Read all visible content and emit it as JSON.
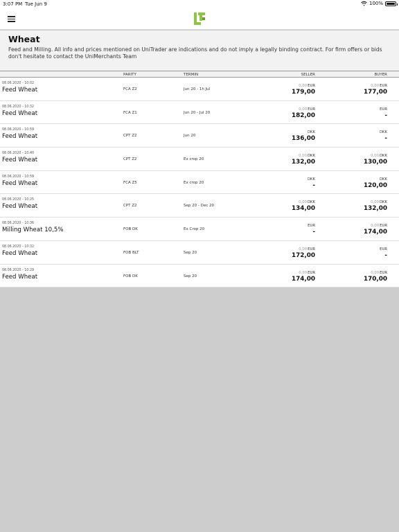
{
  "status_bar": {
    "time": "3:07 PM",
    "date": "Tue Jun 9",
    "battery": "100%"
  },
  "icons": {
    "menu": "hamburger-menu-icon",
    "logo": "unitrader-logo",
    "wifi": "wifi-icon",
    "battery": "battery-icon"
  },
  "colors": {
    "brand": "#8dc63f",
    "header_bg": "#f2f2f2",
    "body_bg": "#cccccc"
  },
  "header": {
    "title": "Wheat",
    "description": "Feed and Milling.  All info and prices mentioned on UniTrader are indications and do not imply a legally binding contract. For firm offers or bids don't hesitate to contact the UniMerchants Team"
  },
  "table": {
    "columns": {
      "parity": "PARITY",
      "termin": "TERMIN",
      "seller": "SELLER",
      "buyer": "BUYER"
    },
    "rows": [
      {
        "timestamp": "08.06.2020 - 10:02",
        "product": "Feed Wheat",
        "parity": "FCA Z2",
        "termin": "Jun 20 - 1h Jul",
        "seller_change": "0,00",
        "seller_currency": "EUR",
        "seller_price": "179,00",
        "buyer_change": "0,00",
        "buyer_currency": "EUR",
        "buyer_price": "177,00"
      },
      {
        "timestamp": "08.06.2020 - 10:32",
        "product": "Feed Wheat",
        "parity": "FCA Z1",
        "termin": "Jun 20 - Jul 20",
        "seller_change": "0,00",
        "seller_currency": "EUR",
        "seller_price": "182,00",
        "buyer_change": "",
        "buyer_currency": "EUR",
        "buyer_price": "-"
      },
      {
        "timestamp": "08.06.2020 - 10:59",
        "product": "Feed Wheat",
        "parity": "CPT Z2",
        "termin": "Jun 20",
        "seller_change": "",
        "seller_currency": "DKK",
        "seller_price": "136,00",
        "buyer_change": "",
        "buyer_currency": "DKK",
        "buyer_price": "-"
      },
      {
        "timestamp": "08.06.2020 - 10:40",
        "product": "Feed Wheat",
        "parity": "CPT Z2",
        "termin": "Ex crop 20",
        "seller_change": "0,00",
        "seller_currency": "DKK",
        "seller_price": "132,00",
        "buyer_change": "0,00",
        "buyer_currency": "DKK",
        "buyer_price": "130,00"
      },
      {
        "timestamp": "08.06.2020 - 10:59",
        "product": "Feed Wheat",
        "parity": "FCA Z5",
        "termin": "Ex crop 20",
        "seller_change": "",
        "seller_currency": "DKK",
        "seller_price": "-",
        "buyer_change": "",
        "buyer_currency": "DKK",
        "buyer_price": "120,00"
      },
      {
        "timestamp": "08.06.2020 - 10:25",
        "product": "Feed Wheat",
        "parity": "CPT Z2",
        "termin": "Sep 20 - Dec 20",
        "seller_change": "0,00",
        "seller_currency": "DKK",
        "seller_price": "134,00",
        "buyer_change": "0,00",
        "buyer_currency": "DKK",
        "buyer_price": "132,00"
      },
      {
        "timestamp": "08.06.2020 - 10:36",
        "product": "Milling Wheat 10,5%",
        "parity": "FOB DK",
        "termin": "Ex Crop 20",
        "seller_change": "",
        "seller_currency": "EUR",
        "seller_price": "-",
        "buyer_change": "0,00",
        "buyer_currency": "EUR",
        "buyer_price": "174,00"
      },
      {
        "timestamp": "08.06.2020 - 10:32",
        "product": "Feed Wheat",
        "parity": "FOB BLT",
        "termin": "Sep 20",
        "seller_change": "0,00",
        "seller_currency": "EUR",
        "seller_price": "172,00",
        "buyer_change": "",
        "buyer_currency": "EUR",
        "buyer_price": "-"
      },
      {
        "timestamp": "08.06.2020 - 10:29",
        "product": "Feed Wheat",
        "parity": "FOB DK",
        "termin": "Sep 20",
        "seller_change": "0,00",
        "seller_currency": "EUR",
        "seller_price": "174,00",
        "buyer_change": "0,00",
        "buyer_currency": "EUR",
        "buyer_price": "170,00"
      }
    ]
  }
}
